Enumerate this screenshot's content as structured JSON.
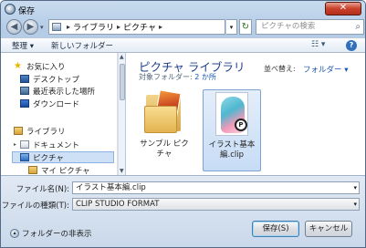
{
  "window": {
    "title": "保存",
    "close_glyph": "✕"
  },
  "nav": {
    "back_glyph": "◀",
    "forward_glyph": "▶",
    "history_glyph": "▾",
    "breadcrumb": [
      "ライブラリ",
      "ピクチャ"
    ],
    "crumb_separator": "▸",
    "refresh_glyph": "↻",
    "search_placeholder": "ピクチャの検索"
  },
  "toolbar": {
    "organize": "整理 ▾",
    "new_folder": "新しいフォルダー",
    "view_glyph": "☷ ▾",
    "help_glyph": "?"
  },
  "sidebar": {
    "items": [
      {
        "label": "お気に入り",
        "icon": "star-icon"
      },
      {
        "label": "デスクトップ",
        "icon": "desktop-icon"
      },
      {
        "label": "最近表示した場所",
        "icon": "recent-places-icon"
      },
      {
        "label": "ダウンロード",
        "icon": "downloads-icon"
      },
      {
        "label": "ライブラリ",
        "icon": "library-icon"
      },
      {
        "label": "ドキュメント",
        "icon": "documents-icon"
      },
      {
        "label": "ピクチャ",
        "icon": "pictures-icon",
        "selected": true
      },
      {
        "label": "マイ ピクチャ",
        "icon": "my-pictures-icon"
      }
    ],
    "star_glyph": "★",
    "expand_glyph": "▸"
  },
  "library": {
    "title": "ピクチャ ライブラリ",
    "subtitle_prefix": "対象フォルダー: ",
    "subtitle_link": "2 か所",
    "sort_label": "並べ替え:",
    "sort_value": "フォルダー ▾"
  },
  "files": [
    {
      "name": "サンプル ピクチャ",
      "type": "folder"
    },
    {
      "name": "イラスト基本編.clip",
      "type": "clip",
      "selected": true
    }
  ],
  "clip_badge_glyph": "P",
  "form": {
    "filename_label": "ファイル名(N):",
    "filename_value": "イラスト基本編.clip",
    "filetype_label": "ファイルの種類(T):",
    "filetype_value": "CLIP STUDIO FORMAT",
    "dropdown_glyph": "▾"
  },
  "footer": {
    "hide_folders": "フォルダーの非表示",
    "hide_glyph": "▴",
    "save": "保存(S)",
    "cancel": "キャンセル"
  }
}
